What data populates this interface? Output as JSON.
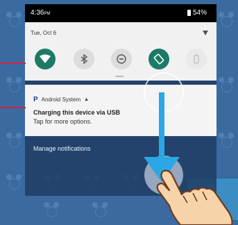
{
  "status_bar": {
    "time": "4:36",
    "time_suffix": "PM",
    "battery": "54%"
  },
  "quick_settings": {
    "date": "Tue, Oct 6",
    "tiles": [
      {
        "name": "wifi",
        "state": "on",
        "icon": "wifi-icon"
      },
      {
        "name": "bluetooth",
        "state": "off",
        "icon": "bluetooth-icon"
      },
      {
        "name": "do-not-disturb",
        "state": "off",
        "icon": "do-not-disturb-icon"
      },
      {
        "name": "auto-rotate",
        "state": "on",
        "icon": "auto-rotate-icon"
      },
      {
        "name": "battery-saver",
        "state": "disabled",
        "icon": "battery-saver-icon"
      }
    ]
  },
  "notification": {
    "app_name": "Android System",
    "title": "Charging this device via USB",
    "body": "Tap for more options."
  },
  "manage_label": "Manage notifications",
  "colors": {
    "tile_on": "#1c7a66",
    "arrow": "#2ba7e6",
    "pointer": "#d4213d",
    "wallpaper": "#3b6aa1"
  }
}
